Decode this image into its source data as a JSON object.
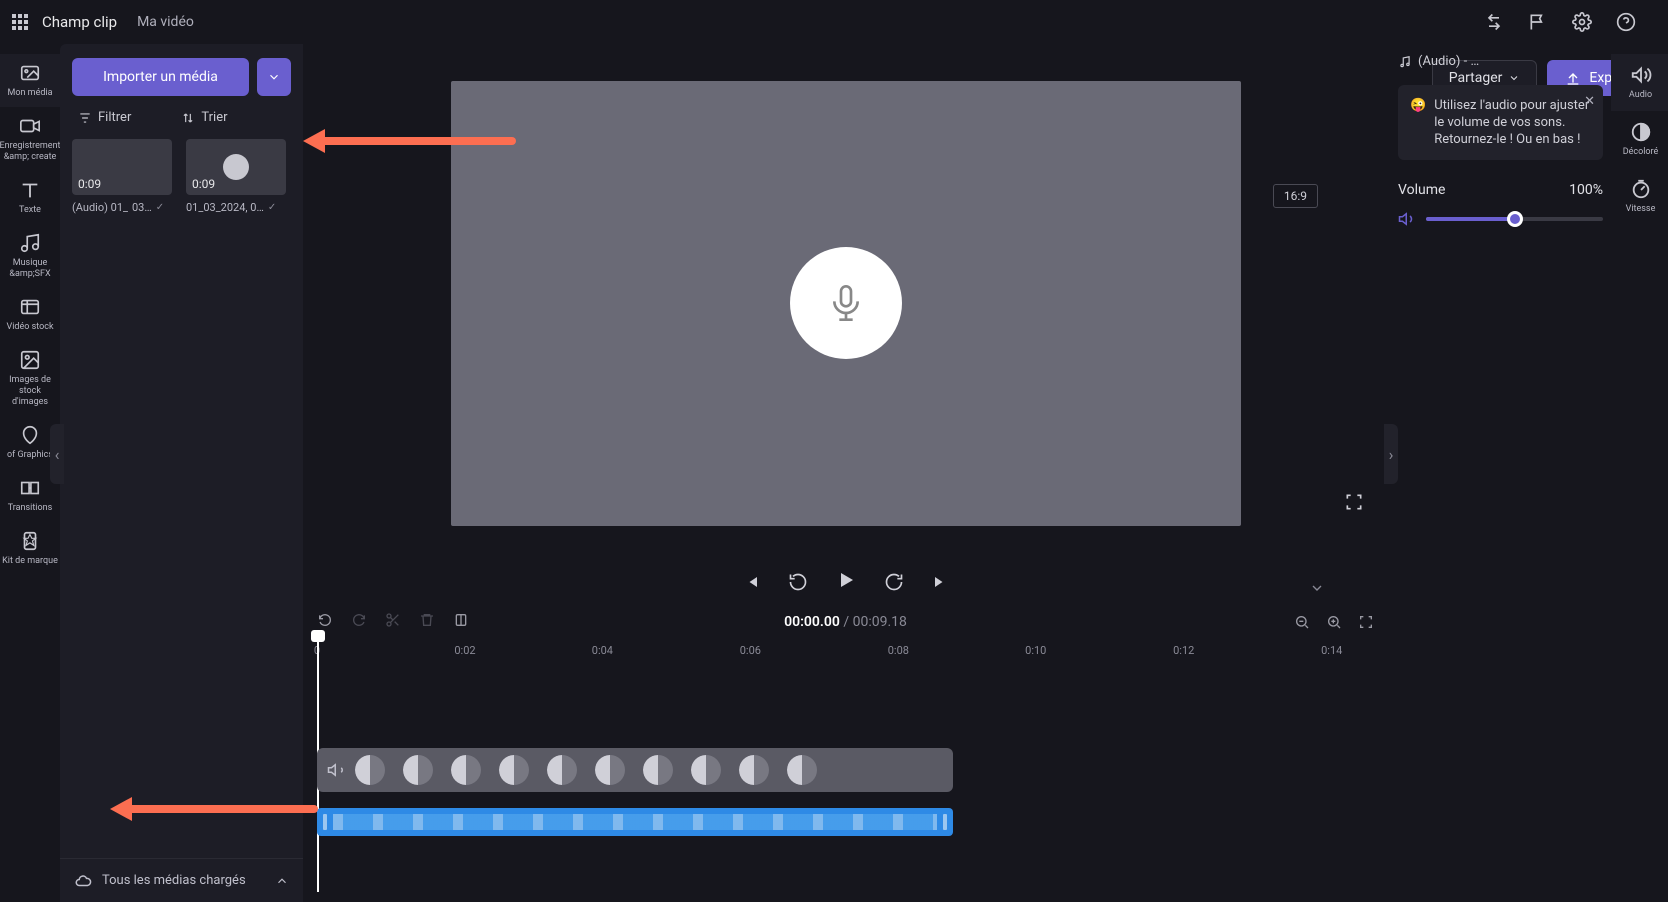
{
  "topbar": {
    "title": "Champ clip",
    "subtitle": "Ma vidéo"
  },
  "leftnav": [
    {
      "id": "my-media",
      "label": "Mon média"
    },
    {
      "id": "record",
      "label": "Enregistrement &amp; create"
    },
    {
      "id": "text",
      "label": "Texte"
    },
    {
      "id": "music",
      "label": "Musique &amp;SFX"
    },
    {
      "id": "stock-video",
      "label": "Vidéo stock"
    },
    {
      "id": "stock-images",
      "label": "Images de stock d'images"
    },
    {
      "id": "graphics",
      "label": "of Graphics"
    },
    {
      "id": "transitions",
      "label": "Transitions"
    },
    {
      "id": "brand",
      "label": "Kit de marque"
    }
  ],
  "media_panel": {
    "import_label": "Importer un média",
    "filter_label": "Filtrer",
    "sort_label": "Trier",
    "items": [
      {
        "duration": "0:09",
        "name": "(Audio) 01_",
        "name2": "03…"
      },
      {
        "duration": "0:09",
        "name": "01_03_2024, 0…"
      }
    ],
    "footer_label": "Tous les médias chargés"
  },
  "preview": {
    "share_label": "Partager",
    "export_label": "Exporter",
    "ratio": "16:9"
  },
  "timeline": {
    "current": "00:00.00",
    "total": "00:09.18",
    "ticks": [
      "0",
      "0:02",
      "0:04",
      "0:06",
      "0:08",
      "0:10",
      "0:12",
      "0:14"
    ]
  },
  "right_panel": {
    "clip_name": "(Audio) - …",
    "tip_emoji": "😜",
    "tip_text": "Utilisez l'audio pour ajuster le volume de vos sons. Retournez-le ! Ou en bas !",
    "volume_label": "Volume",
    "volume_value": "100%",
    "volume_percent": 50
  },
  "rightnav": [
    {
      "id": "audio",
      "label": "Audio"
    },
    {
      "id": "fade",
      "label": "Décoloré"
    },
    {
      "id": "speed",
      "label": "Vitesse"
    }
  ]
}
